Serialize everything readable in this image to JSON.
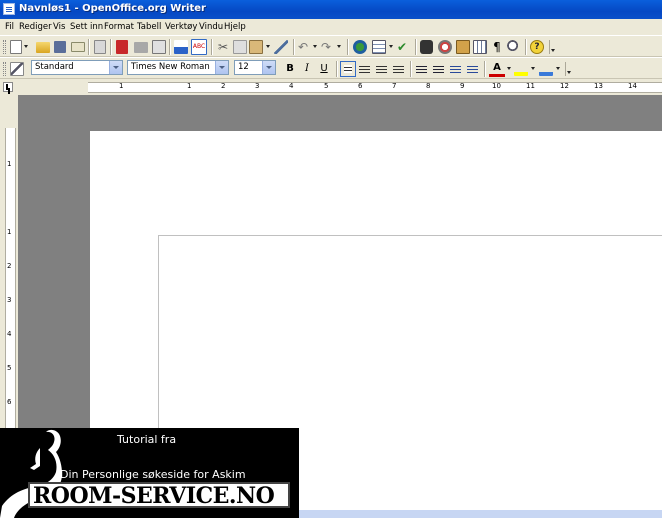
{
  "window": {
    "title": "Navnløs1 - OpenOffice.org Writer"
  },
  "menu": [
    "Fil",
    "Rediger",
    "Vis",
    "Sett inn",
    "Format",
    "Tabell",
    "Verktøy",
    "Vindu",
    "Hjelp"
  ],
  "standard_toolbar": {
    "icons": [
      "new-document-icon",
      "open-icon",
      "save-icon",
      "email-icon",
      "edit-file-icon",
      "export-pdf-icon",
      "print-icon",
      "print-preview-icon",
      "spellcheck-icon",
      "autospellcheck-icon",
      "cut-icon",
      "copy-icon",
      "paste-icon",
      "format-paintbrush-icon",
      "undo-icon",
      "redo-icon",
      "hyperlink-icon",
      "table-icon",
      "show-draw-functions-icon",
      "find-replace-icon",
      "navigator-icon",
      "gallery-icon",
      "data-sources-icon",
      "nonprinting-characters-icon",
      "zoom-icon",
      "help-icon"
    ]
  },
  "formatting_toolbar": {
    "paragraph_style": "Standard",
    "font_name": "Times New Roman",
    "font_size": "12",
    "bold_label": "B",
    "italic_label": "I",
    "underline_label": "U"
  },
  "ruler": {
    "h_numbers": [
      "1",
      "1",
      "2",
      "3",
      "4",
      "5",
      "6",
      "7",
      "8",
      "9",
      "10",
      "11",
      "12",
      "13",
      "14"
    ],
    "v_numbers": [
      "1",
      "1",
      "2",
      "3",
      "4",
      "5",
      "6"
    ]
  },
  "banner": {
    "intro": "Tutorial fra",
    "tagline": "Din Personlige søkeside for Askim",
    "brand": "ROOM-SERVICE.NO"
  },
  "colors": {
    "title_bar": "#0a5fdc",
    "workspace": "#808080",
    "page": "#ffffff",
    "font_color": "#cc0000",
    "highlight": "#ffff00"
  }
}
